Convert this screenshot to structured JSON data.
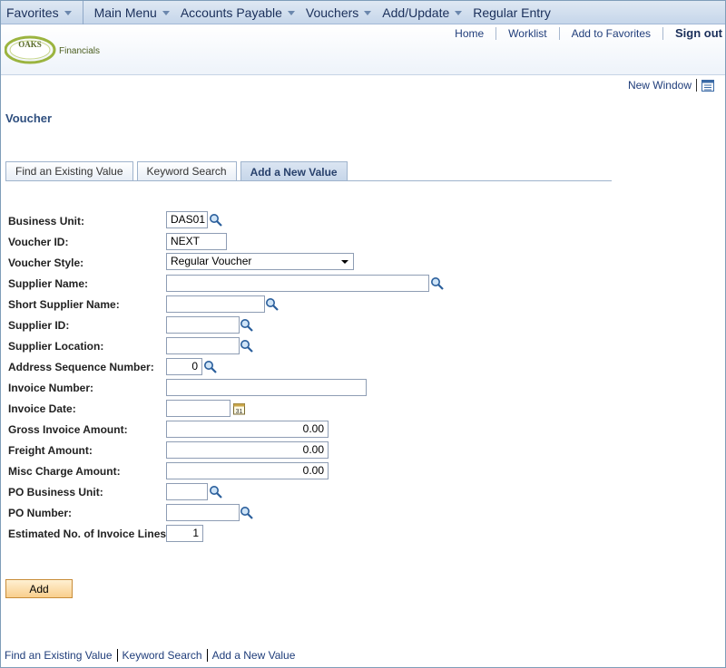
{
  "nav": {
    "favorites": "Favorites",
    "breadcrumbs": [
      "Main Menu",
      "Accounts Payable",
      "Vouchers",
      "Add/Update",
      "Regular Entry"
    ]
  },
  "header": {
    "logo_top": "OAKS",
    "logo_text": "Financials",
    "links": [
      "Home",
      "Worklist",
      "Add to Favorites",
      "Sign out"
    ]
  },
  "new_window": "New Window",
  "page_title": "Voucher",
  "tabs": [
    "Find an Existing Value",
    "Keyword Search",
    "Add a New Value"
  ],
  "fields": {
    "business_unit": {
      "label": "Business Unit:",
      "value": "DAS01"
    },
    "voucher_id": {
      "label": "Voucher ID:",
      "value": "NEXT"
    },
    "voucher_style": {
      "label": "Voucher Style:",
      "value": "Regular Voucher"
    },
    "supplier_name": {
      "label": "Supplier Name:",
      "value": ""
    },
    "short_supplier_name": {
      "label": "Short Supplier Name:",
      "value": ""
    },
    "supplier_id": {
      "label": "Supplier ID:",
      "value": ""
    },
    "supplier_location": {
      "label": "Supplier Location:",
      "value": ""
    },
    "address_seq": {
      "label": "Address Sequence Number:",
      "value": "0"
    },
    "invoice_number": {
      "label": "Invoice Number:",
      "value": ""
    },
    "invoice_date": {
      "label": "Invoice Date:",
      "value": ""
    },
    "gross_amount": {
      "label": "Gross Invoice Amount:",
      "value": "0.00"
    },
    "freight_amount": {
      "label": "Freight Amount:",
      "value": "0.00"
    },
    "misc_amount": {
      "label": "Misc Charge Amount:",
      "value": "0.00"
    },
    "po_business_unit": {
      "label": "PO Business Unit:",
      "value": ""
    },
    "po_number": {
      "label": "PO Number:",
      "value": ""
    },
    "invoice_lines": {
      "label": "Estimated No. of Invoice Lines:",
      "value": "1"
    }
  },
  "add_button": "Add",
  "footer_links": [
    "Find an Existing Value",
    "Keyword Search",
    "Add a New Value"
  ],
  "colors": {
    "link": "#1f3d7a",
    "title": "#2f4f7f",
    "button": "#f9cf8d"
  }
}
